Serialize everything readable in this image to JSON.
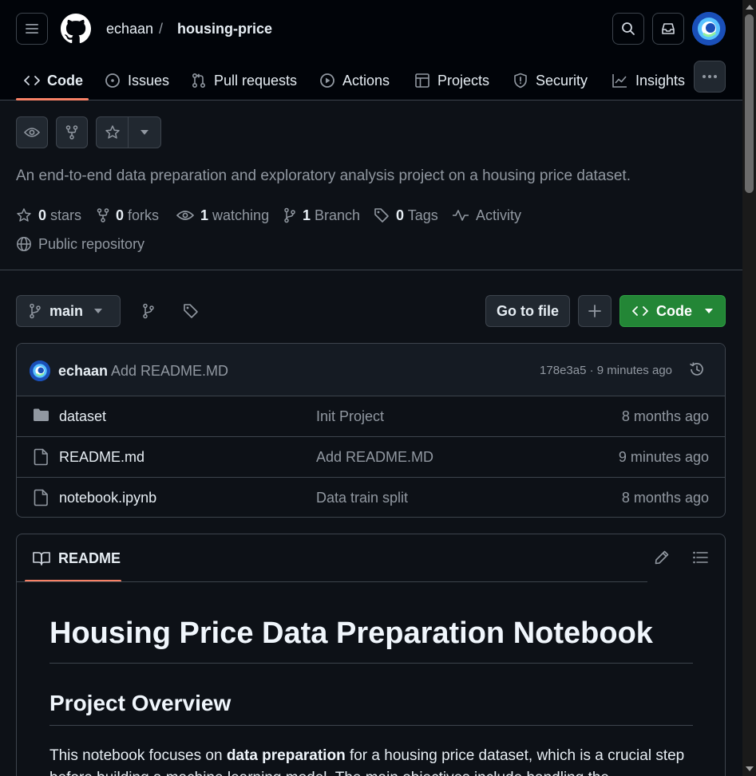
{
  "header": {
    "owner": "echaan",
    "separator": "/",
    "repo": "housing-price"
  },
  "nav": {
    "tabs": [
      {
        "label": "Code",
        "icon": "code-icon",
        "active": true
      },
      {
        "label": "Issues",
        "icon": "issue-opened-icon"
      },
      {
        "label": "Pull requests",
        "icon": "git-pull-request-icon"
      },
      {
        "label": "Actions",
        "icon": "play-icon"
      },
      {
        "label": "Projects",
        "icon": "table-icon"
      },
      {
        "label": "Security",
        "icon": "shield-icon"
      },
      {
        "label": "Insights",
        "icon": "graph-icon"
      }
    ]
  },
  "repo": {
    "description": "An end-to-end data preparation and exploratory analysis project on a housing price dataset.",
    "stats": {
      "stars_count": "0",
      "stars_label": "stars",
      "forks_count": "0",
      "forks_label": "forks",
      "watching_count": "1",
      "watching_label": "watching",
      "branch_count": "1",
      "branch_label": "Branch",
      "tags_count": "0",
      "tags_label": "Tags",
      "activity_label": "Activity"
    },
    "visibility": "Public repository"
  },
  "branch_bar": {
    "branch": "main",
    "goto_file": "Go to file",
    "code_button": "Code"
  },
  "latest_commit": {
    "author": "echaan",
    "message": "Add README.MD",
    "meta": "178e3a5 · 9 minutes ago"
  },
  "files": [
    {
      "name": "dataset",
      "type": "folder",
      "message": "Init Project",
      "time": "8 months ago"
    },
    {
      "name": "README.md",
      "type": "file",
      "message": "Add README.MD",
      "time": "9 minutes ago"
    },
    {
      "name": "notebook.ipynb",
      "type": "file",
      "message": "Data train split",
      "time": "8 months ago"
    }
  ],
  "readme": {
    "tab_label": "README",
    "h1": "Housing Price Data Preparation Notebook",
    "h2": "Project Overview",
    "para_prefix": "This notebook focuses on ",
    "para_bold": "data preparation",
    "para_suffix": " for a housing price dataset, which is a crucial step before building a machine learning model. The main objectives include handling the"
  },
  "colors": {
    "accent_underline": "#f78166",
    "code_button_green": "#238636",
    "background": "#0d1117",
    "header_background": "#010409"
  }
}
